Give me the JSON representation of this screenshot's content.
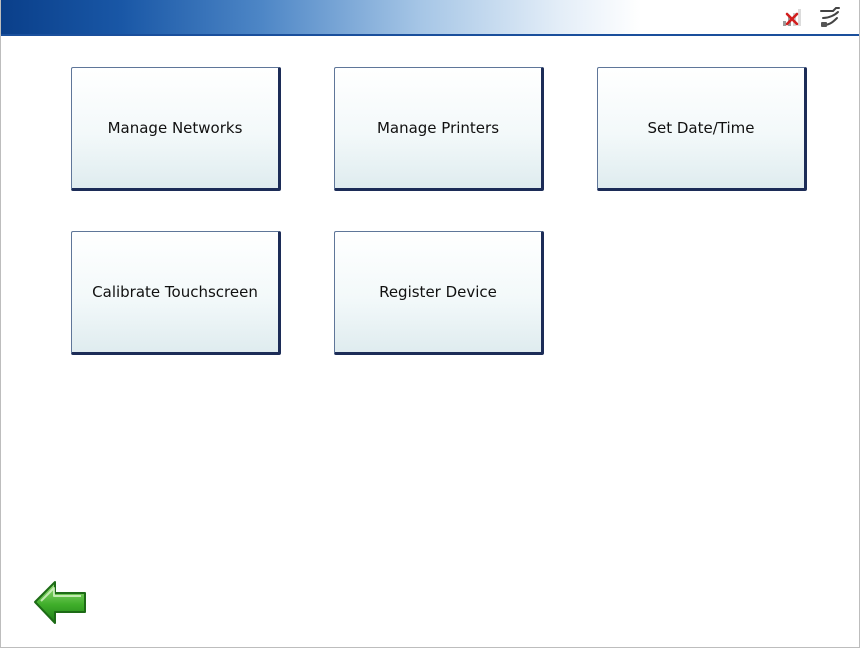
{
  "header": {
    "status_icons": [
      "signal-disconnected-icon",
      "network-cable-icon"
    ]
  },
  "menu": {
    "items": [
      {
        "label": "Manage Networks"
      },
      {
        "label": "Manage Printers"
      },
      {
        "label": "Set Date/Time"
      },
      {
        "label": "Calibrate Touchscreen"
      },
      {
        "label": "Register Device"
      }
    ]
  },
  "nav": {
    "back_icon": "back-arrow-icon"
  },
  "colors": {
    "header_dark": "#0a3f8a",
    "tile_border": "#1c2c57",
    "back_arrow": "#3fae2a"
  }
}
